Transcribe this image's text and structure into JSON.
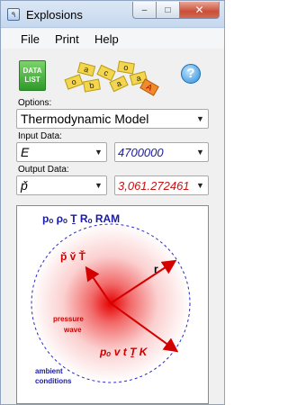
{
  "window": {
    "title": "Explosions",
    "app_icon_glyph": "٩",
    "minimize_glyph": "–",
    "maximize_glyph": "□",
    "close_glyph": "✕"
  },
  "menu": {
    "items": [
      "File",
      "Print",
      "Help"
    ]
  },
  "toolbar": {
    "data_list_label_line1": "DATA",
    "data_list_label_line2": "LIST",
    "help_glyph": "?",
    "tiles": [
      "o",
      "a",
      "b",
      "c",
      "a",
      "o",
      "a",
      "A"
    ]
  },
  "options": {
    "label": "Options:",
    "model_value": "Thermodynamic Model"
  },
  "input": {
    "label": "Input Data:",
    "variable": "E",
    "value": "4700000"
  },
  "output": {
    "label": "Output Data:",
    "variable": "p̌",
    "value": "3,061.272461"
  },
  "diagram": {
    "top_label": "pₒ ρₒ Ṯ Rₒ RAM",
    "center_label": "p̌ v̌ Ť",
    "radius_label": "r",
    "wave_label_line1": "pressure",
    "wave_label_line2": "wave",
    "front_label": "pₒ v t Ṯ K",
    "ambient_label_line1": "ambient",
    "ambient_label_line2": "conditions"
  },
  "colors": {
    "accent_blue": "#1a1aa6",
    "output_red": "#cc1111",
    "input_blue": "#1a1aa6",
    "arrow_red": "#d40000"
  },
  "icons": {
    "app": "app-icon",
    "data_list": "data-list-icon",
    "tiles": "letter-tiles-icon",
    "help": "help-icon",
    "dropdown": "chevron-down-icon"
  }
}
